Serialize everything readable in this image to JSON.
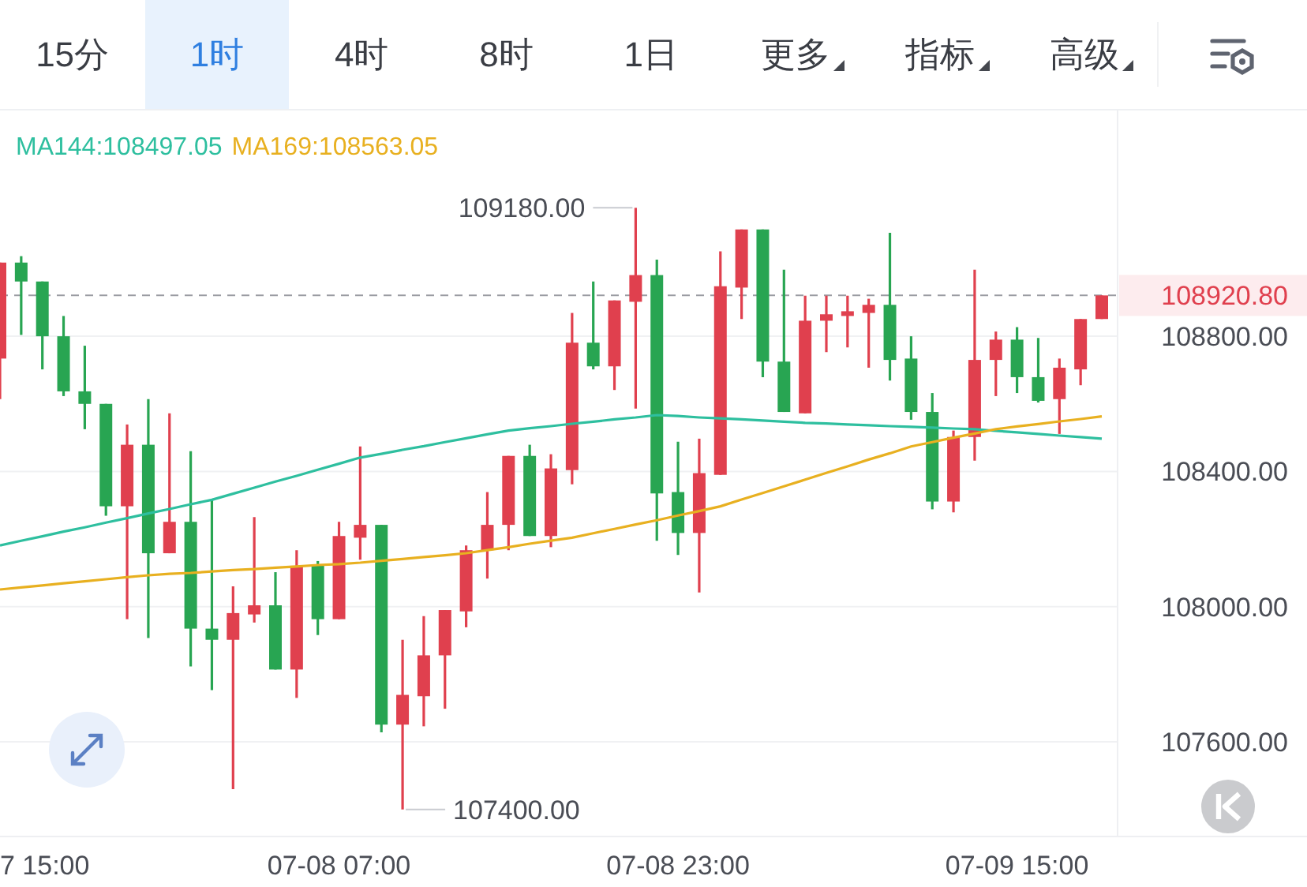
{
  "tabs": [
    {
      "label": "15分",
      "selected": false,
      "has_menu": false
    },
    {
      "label": "1时",
      "selected": true,
      "has_menu": false
    },
    {
      "label": "4时",
      "selected": false,
      "has_menu": false
    },
    {
      "label": "8时",
      "selected": false,
      "has_menu": false
    },
    {
      "label": "1日",
      "selected": false,
      "has_menu": false
    },
    {
      "label": "更多",
      "selected": false,
      "has_menu": true
    },
    {
      "label": "指标",
      "selected": false,
      "has_menu": true
    },
    {
      "label": "高级",
      "selected": false,
      "has_menu": true
    }
  ],
  "legend": [
    {
      "separator": ":",
      "value": "108497.05"
    },
    {
      "separator": ":",
      "value": "108563.05"
    }
  ],
  "cut_time_label": "7 15:00",
  "chart_data": {
    "type": "candlestick",
    "yticks": [
      {
        "value": 108800,
        "label": "108800.00"
      },
      {
        "value": 108400,
        "label": "108400.00"
      },
      {
        "value": 108000,
        "label": "108000.00"
      },
      {
        "value": 107600,
        "label": "107600.00"
      }
    ],
    "ylim": [
      107320,
      109468
    ],
    "grid": true,
    "ref_lines": [
      {
        "axis": "y",
        "value": 108920.8,
        "label": "108920.80"
      }
    ],
    "annotations": [
      "109180.00",
      "107400.00"
    ],
    "categories": [
      null,
      null,
      null,
      null,
      null,
      null,
      null,
      null,
      null,
      null,
      null,
      null,
      null,
      null,
      null,
      null,
      "07-08 07:00",
      null,
      null,
      null,
      null,
      null,
      null,
      null,
      null,
      null,
      null,
      null,
      null,
      null,
      null,
      null,
      "07-08 23:00",
      null,
      null,
      null,
      null,
      null,
      null,
      null,
      null,
      null,
      null,
      null,
      null,
      null,
      null,
      null,
      "07-09 15:00",
      null,
      null,
      null,
      null
    ],
    "ohlc": [
      [
        108734,
        109018,
        108614,
        109018
      ],
      [
        109018,
        109037,
        108804,
        108962
      ],
      [
        108962,
        108962,
        108702,
        108800
      ],
      [
        108800,
        108860,
        108623,
        108637
      ],
      [
        108637,
        108772,
        108525,
        108600
      ],
      [
        108600,
        108600,
        108269,
        108297
      ],
      [
        108297,
        108539,
        107963,
        108479
      ],
      [
        108479,
        108614,
        107907,
        108158
      ],
      [
        108158,
        108572,
        108158,
        108251
      ],
      [
        108251,
        108460,
        107823,
        107935
      ],
      [
        107935,
        108316,
        107753,
        107902
      ],
      [
        107902,
        108060,
        107460,
        107981
      ],
      [
        107977,
        108265,
        107953,
        108004
      ],
      [
        108004,
        108102,
        107814,
        107814
      ],
      [
        107814,
        108167,
        107730,
        108121
      ],
      [
        108121,
        108135,
        107916,
        107963
      ],
      [
        107963,
        108251,
        107963,
        108209
      ],
      [
        108204,
        108474,
        108139,
        108242
      ],
      [
        108242,
        108242,
        107628,
        107651
      ],
      [
        107651,
        107902,
        107400,
        107739
      ],
      [
        107735,
        107972,
        107646,
        107856
      ],
      [
        107856,
        107990,
        107698,
        107990
      ],
      [
        107986,
        108181,
        107939,
        108167
      ],
      [
        108167,
        108339,
        108083,
        108242
      ],
      [
        108242,
        108446,
        108167,
        108446
      ],
      [
        108446,
        108479,
        108209,
        108209
      ],
      [
        108209,
        108451,
        108176,
        108409
      ],
      [
        108404,
        108869,
        108362,
        108781
      ],
      [
        108781,
        108962,
        108702,
        108711
      ],
      [
        108711,
        108906,
        108641,
        108906
      ],
      [
        108902,
        109180,
        108586,
        108981
      ],
      [
        108981,
        109027,
        108195,
        108335
      ],
      [
        108339,
        108488,
        108153,
        108218
      ],
      [
        108218,
        108497,
        108042,
        108395
      ],
      [
        108390,
        109051,
        108390,
        108948
      ],
      [
        108944,
        109116,
        108851,
        109116
      ],
      [
        109116,
        109116,
        108679,
        108725
      ],
      [
        108725,
        108997,
        108576,
        108576
      ],
      [
        108572,
        108920,
        108572,
        108846
      ],
      [
        108846,
        108920,
        108753,
        108865
      ],
      [
        108860,
        108920,
        108767,
        108874
      ],
      [
        108869,
        108911,
        108707,
        108893
      ],
      [
        108893,
        109106,
        108669,
        108730
      ],
      [
        108734,
        108800,
        108553,
        108576
      ],
      [
        108576,
        108632,
        108288,
        108311
      ],
      [
        108311,
        108521,
        108279,
        108502
      ],
      [
        108502,
        108997,
        108432,
        108730
      ],
      [
        108730,
        108814,
        108623,
        108790
      ],
      [
        108790,
        108827,
        108632,
        108679
      ],
      [
        108679,
        108795,
        108604,
        108609
      ],
      [
        108614,
        108734,
        108511,
        108707
      ],
      [
        108702,
        108851,
        108655,
        108851
      ],
      [
        108851,
        108920.8,
        108851,
        108920.8
      ]
    ],
    "series": [
      {
        "name": "MA144",
        "type": "line",
        "color": "#2ebf9f",
        "values": [
          108181,
          108195,
          108208,
          108222,
          108235,
          108249,
          108262,
          108276,
          108289,
          108303,
          108316,
          108334,
          108352,
          108370,
          108387,
          108405,
          108423,
          108441,
          108452,
          108464,
          108475,
          108487,
          108498,
          108510,
          108521,
          108528,
          108534,
          108541,
          108547,
          108554,
          108560,
          108567,
          108564,
          108560,
          108557,
          108554,
          108551,
          108547,
          108544,
          108542,
          108539,
          108537,
          108534,
          108532,
          108530,
          108527,
          108525,
          108520,
          108516,
          108511,
          108506,
          108502,
          108497
        ]
      },
      {
        "name": "MA169",
        "type": "line",
        "color": "#e8b020",
        "values": [
          108051,
          108057,
          108063,
          108069,
          108075,
          108081,
          108087,
          108093,
          108097,
          108100,
          108104,
          108108,
          108111,
          108115,
          108119,
          108123,
          108126,
          108130,
          108136,
          108141,
          108147,
          108152,
          108158,
          108167,
          108176,
          108186,
          108195,
          108204,
          108217,
          108230,
          108243,
          108256,
          108270,
          108283,
          108297,
          108317,
          108336,
          108356,
          108376,
          108396,
          108415,
          108435,
          108454,
          108474,
          108487,
          108500,
          108512,
          108525,
          108533,
          108540,
          108548,
          108555,
          108563
        ]
      }
    ]
  }
}
